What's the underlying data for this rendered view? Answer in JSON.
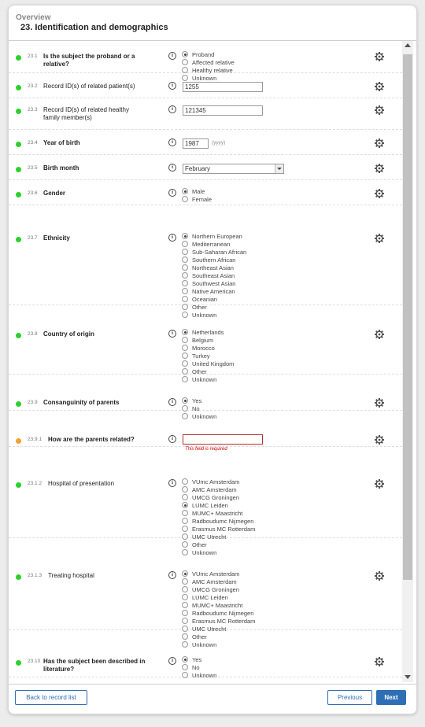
{
  "header": {
    "overview": "Overview",
    "title": "23. Identification and demographics"
  },
  "footer": {
    "back_label": "Back to record list",
    "previous_label": "Previous",
    "next_label": "Next"
  },
  "icons": {
    "info": "info-icon",
    "gear": "gear-icon"
  },
  "colors": {
    "status_complete": "#2bd12b",
    "status_required": "#f5a030",
    "accent": "#2e6eb5",
    "error": "#cc0000"
  },
  "questions": [
    {
      "num": "23.1",
      "text": "Is the subject the proband or a relative?",
      "bold": true,
      "options": [
        "Proband",
        "Affected relative",
        "Healthy relative",
        "Unknown"
      ],
      "selected": 0
    },
    {
      "num": "23.2",
      "text": "Record ID(s) of related patient(s)",
      "bold": false,
      "value": "1255"
    },
    {
      "num": "23.3",
      "text": "Record ID(s) of related healthy family member(s)",
      "bold": false,
      "value": "121345"
    },
    {
      "num": "23.4",
      "text": "Year of birth",
      "bold": true,
      "value": "1987",
      "hint": "(yyyy)"
    },
    {
      "num": "23.5",
      "text": "Birth month",
      "bold": true,
      "selected_value": "February"
    },
    {
      "num": "23.6",
      "text": "Gender",
      "bold": true,
      "options": [
        "Male",
        "Female"
      ],
      "selected": 0
    },
    {
      "num": "23.7",
      "text": "Ethnicity",
      "bold": true,
      "options": [
        "Northern European",
        "Mediterranean",
        "Sub-Saharan African",
        "Southern African",
        "Northeast Asian",
        "Southeast Asian",
        "Southwest Asian",
        "Native American",
        "Oceanian",
        "Other",
        "Unknown"
      ],
      "selected": 0
    },
    {
      "num": "23.8",
      "text": "Country of origin",
      "bold": true,
      "options": [
        "Netherlands",
        "Belgium",
        "Morocco",
        "Turkey",
        "United Kingdom",
        "Other",
        "Unknown"
      ],
      "selected": 0
    },
    {
      "num": "23.9",
      "text": "Consanguinity of parents",
      "bold": true,
      "options": [
        "Yes",
        "No",
        "Unknown"
      ],
      "selected": 0
    },
    {
      "num": "23.9.1",
      "text": "How are the parents related?",
      "bold": true,
      "value": "",
      "error": "This field is required"
    },
    {
      "num": "23.1.2",
      "text": "Hospital of presentation",
      "bold": false,
      "options": [
        "VUmc Amsterdam",
        "AMC Amsterdam",
        "UMCG Groningen",
        "LUMC Leiden",
        "MUMC+ Maastricht",
        "Radboudumc Nijmegen",
        "Erasmus MC Rotterdam",
        "UMC Utrecht",
        "Other",
        "Unknown"
      ],
      "selected": 3
    },
    {
      "num": "23.1.3",
      "text": "Treating hospital",
      "bold": false,
      "options": [
        "VUmc Amsterdam",
        "AMC Amsterdam",
        "UMCG Groningen",
        "LUMC Leiden",
        "MUMC+ Maastricht",
        "Radboudumc Nijmegen",
        "Erasmus MC Rotterdam",
        "UMC Utrecht",
        "Other",
        "Unknown"
      ],
      "selected": 0
    },
    {
      "num": "23.10",
      "text": "Has the subject been described in literature?",
      "bold": true,
      "options": [
        "Yes",
        "No",
        "Unknown"
      ],
      "selected": 0
    }
  ]
}
